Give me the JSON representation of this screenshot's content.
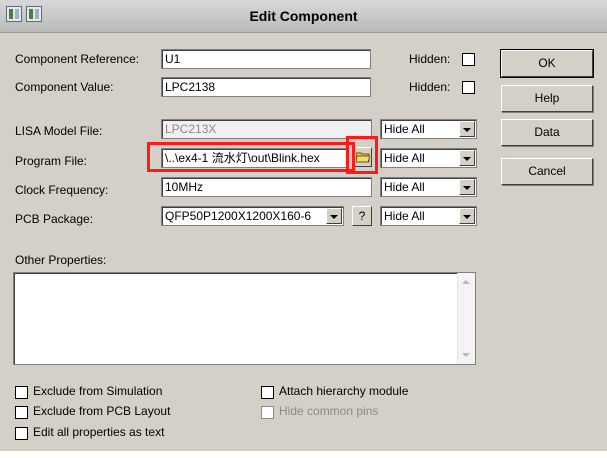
{
  "window": {
    "title": "Edit Component"
  },
  "fields": {
    "component_reference": {
      "label": "Component Reference:",
      "value": "U1",
      "hidden_label": "Hidden:"
    },
    "component_value": {
      "label": "Component Value:",
      "value": "LPC2138",
      "hidden_label": "Hidden:"
    },
    "lisa_model_file": {
      "label": "LISA Model File:",
      "value": "LPC213X",
      "visibility": "Hide All"
    },
    "program_file": {
      "label": "Program File:",
      "value": "\\..\\ex4-1 流水灯\\out\\Blink.hex",
      "visibility": "Hide All"
    },
    "clock_frequency": {
      "label": "Clock Frequency:",
      "value": "10MHz",
      "visibility": "Hide All"
    },
    "pcb_package": {
      "label": "PCB Package:",
      "value": "QFP50P1200X1200X160-6",
      "help_label": "?",
      "visibility": "Hide All"
    },
    "other_properties": {
      "label": "Other Properties:",
      "value": ""
    }
  },
  "buttons": {
    "ok": "OK",
    "help": "Help",
    "data": "Data",
    "cancel": "Cancel"
  },
  "checkboxes": {
    "exclude_simulation": "Exclude from Simulation",
    "exclude_pcb": "Exclude from PCB Layout",
    "edit_all": "Edit all properties as text",
    "attach_hierarchy": "Attach hierarchy module",
    "hide_common_pins": "Hide common pins"
  },
  "highlight_color": "#ff1a1a",
  "icons": {
    "browse": "folder-icon",
    "sys1": "app-icon",
    "sys2": "app-icon"
  }
}
